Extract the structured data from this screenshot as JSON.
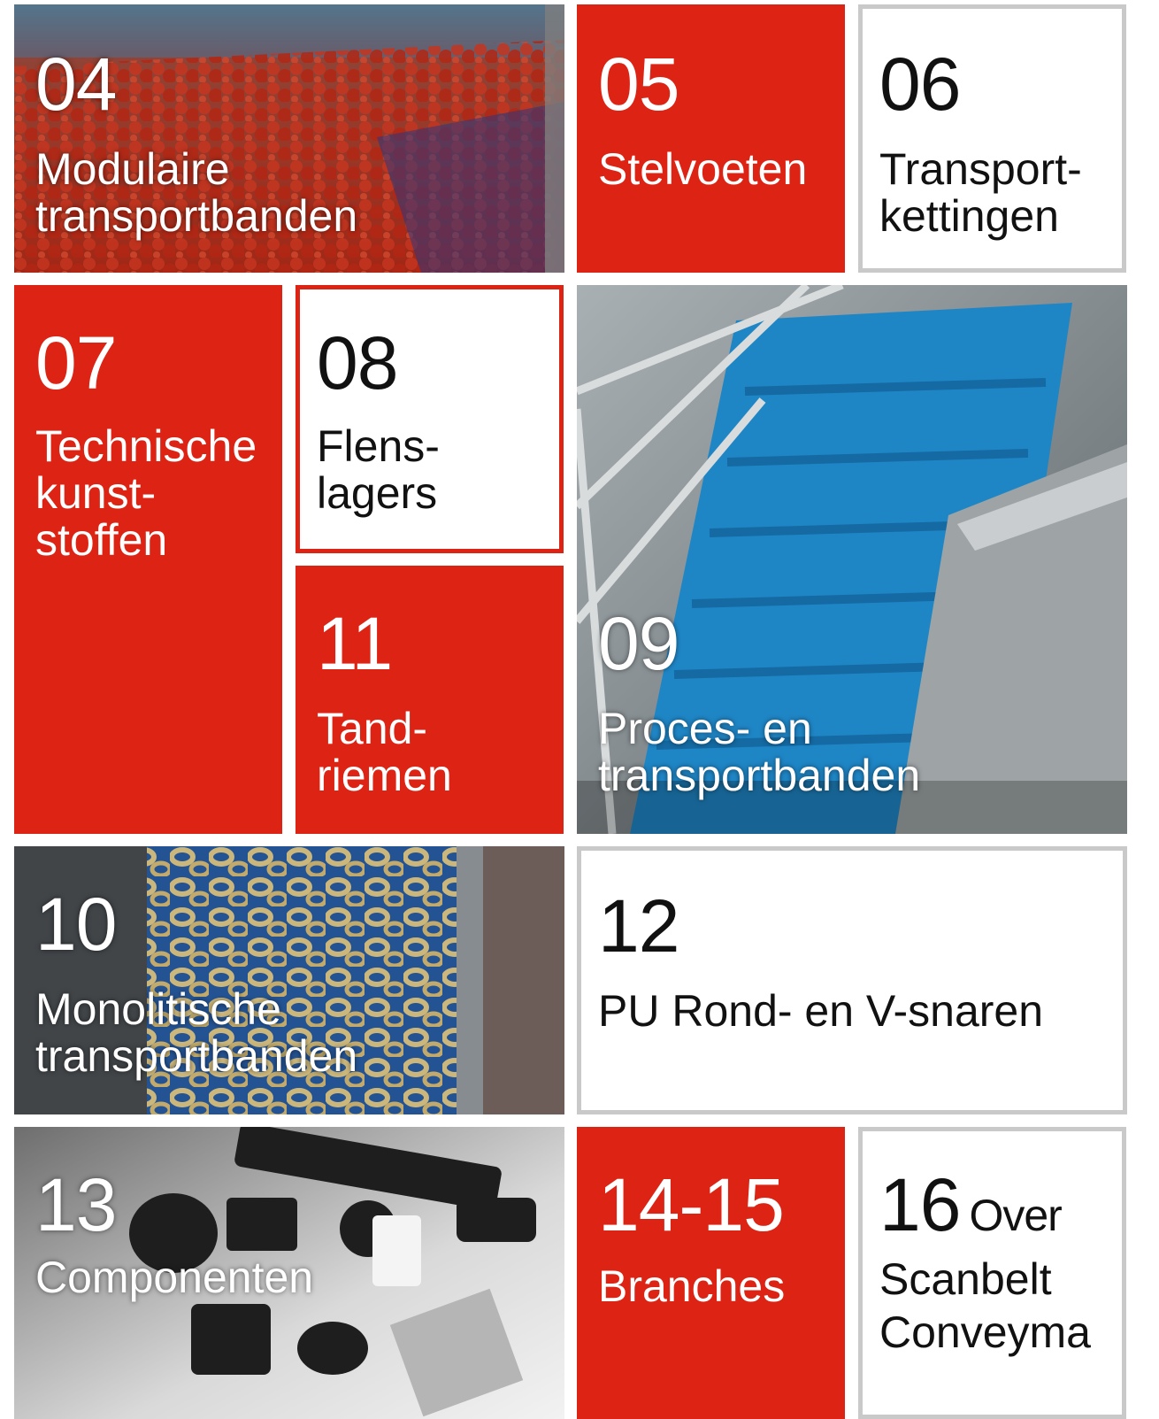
{
  "tiles": {
    "t04": {
      "number": "04",
      "label": "Modulaire\ntransportbanden"
    },
    "t05": {
      "number": "05",
      "label": "Stelvoeten"
    },
    "t06": {
      "number": "06",
      "label": "Transport-\nkettingen"
    },
    "t07": {
      "number": "07",
      "label": "Technische\nkunst-\nstoffen"
    },
    "t08": {
      "number": "08",
      "label": "Flens-\nlagers"
    },
    "t09": {
      "number": "09",
      "label": "Proces- en\ntransportbanden"
    },
    "t10": {
      "number": "10",
      "label": "Monolitische\ntransportbanden"
    },
    "t11": {
      "number": "11",
      "label": "Tand-\nriemen"
    },
    "t12": {
      "number": "12",
      "label": "PU Rond- en V-snaren"
    },
    "t13": {
      "number": "13",
      "label": "Componenten"
    },
    "t14": {
      "number": "14-15",
      "label": "Branches"
    },
    "t16": {
      "number": "16",
      "label_inline": "Over",
      "label": "Scanbelt\nConveyma"
    }
  },
  "colors": {
    "accent_red": "#dc2314",
    "border_grey": "#c9c9c9",
    "text_dark": "#111111"
  }
}
